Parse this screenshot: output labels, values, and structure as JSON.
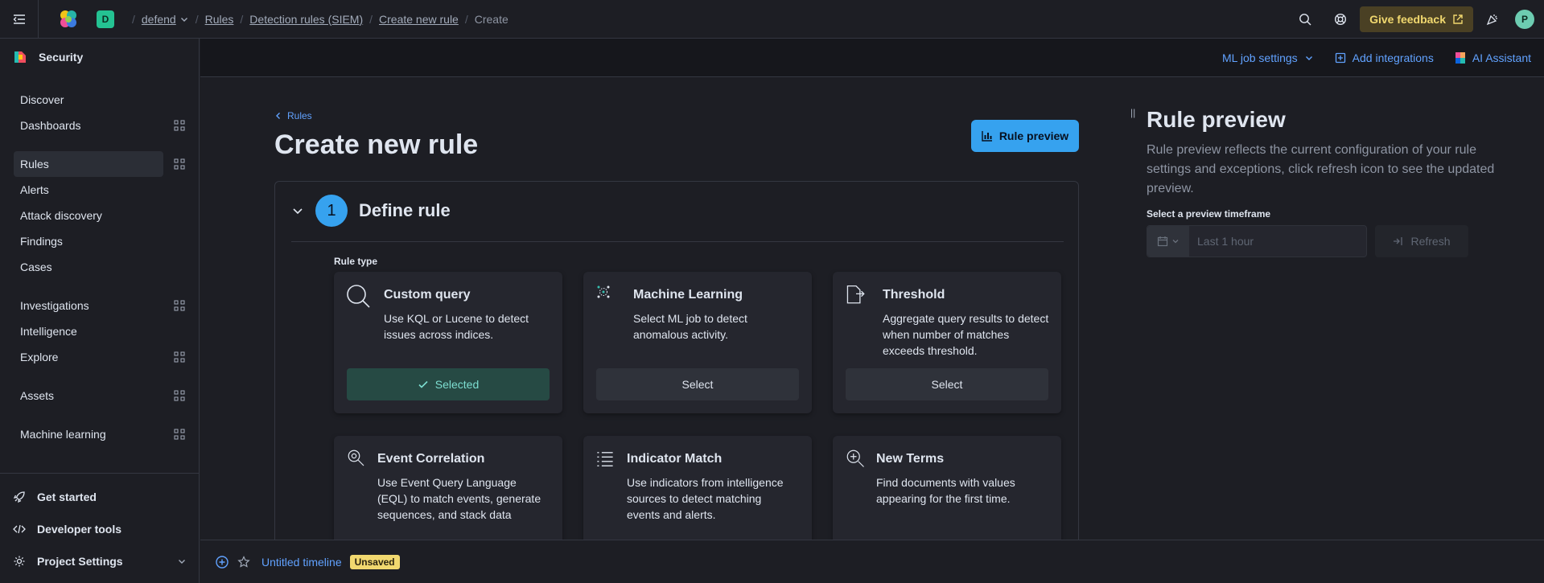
{
  "header": {
    "deployment_initial": "D",
    "breadcrumbs": {
      "space": "defend",
      "rules": "Rules",
      "detection_rules": "Detection rules (SIEM)",
      "create_new_rule": "Create new rule",
      "current": "Create"
    },
    "feedback_label": "Give feedback",
    "user_initial": "P"
  },
  "sidebar": {
    "title": "Security",
    "items": {
      "discover": "Discover",
      "dashboards": "Dashboards",
      "rules": "Rules",
      "alerts": "Alerts",
      "attack_discovery": "Attack discovery",
      "findings": "Findings",
      "cases": "Cases",
      "investigations": "Investigations",
      "intelligence": "Intelligence",
      "explore": "Explore",
      "assets": "Assets",
      "machine_learning": "Machine learning"
    },
    "active_item": "Rules",
    "bottom": {
      "get_started": "Get started",
      "developer_tools": "Developer tools",
      "project_settings": "Project Settings"
    }
  },
  "subbar": {
    "ml_job_settings": "ML job settings",
    "add_integrations": "Add integrations",
    "ai_assistant": "AI Assistant"
  },
  "main": {
    "back_link": "Rules",
    "title": "Create new rule",
    "rule_preview_button": "Rule preview",
    "step": {
      "number": "1",
      "title": "Define rule"
    },
    "rule_type_label": "Rule type",
    "cards": {
      "custom_query": {
        "title": "Custom query",
        "description": "Use KQL or Lucene to detect issues across indices.",
        "button": "Selected"
      },
      "machine_learning": {
        "title": "Machine Learning",
        "description": "Select ML job to detect anomalous activity.",
        "button": "Select"
      },
      "threshold": {
        "title": "Threshold",
        "description": "Aggregate query results to detect when number of matches exceeds threshold.",
        "button": "Select"
      },
      "event_correlation": {
        "title": "Event Correlation",
        "description": "Use Event Query Language (EQL) to match events, generate sequences, and stack data"
      },
      "indicator_match": {
        "title": "Indicator Match",
        "description": "Use indicators from intelligence sources to detect matching events and alerts."
      },
      "new_terms": {
        "title": "New Terms",
        "description": "Find documents with values appearing for the first time."
      }
    }
  },
  "preview": {
    "title": "Rule preview",
    "description": "Rule preview reflects the current configuration of your rule settings and exceptions, click refresh icon to see the updated preview.",
    "timeframe_label": "Select a preview timeframe",
    "timeframe_placeholder": "Last 1 hour",
    "refresh_label": "Refresh"
  },
  "timeline": {
    "name": "Untitled timeline",
    "badge": "Unsaved"
  },
  "colors": {
    "accent": "#36a2ef",
    "link": "#61a2ff",
    "selected_bg": "#264a44",
    "feedback_bg": "#4a4024",
    "unsaved_badge": "#f1d86f"
  }
}
